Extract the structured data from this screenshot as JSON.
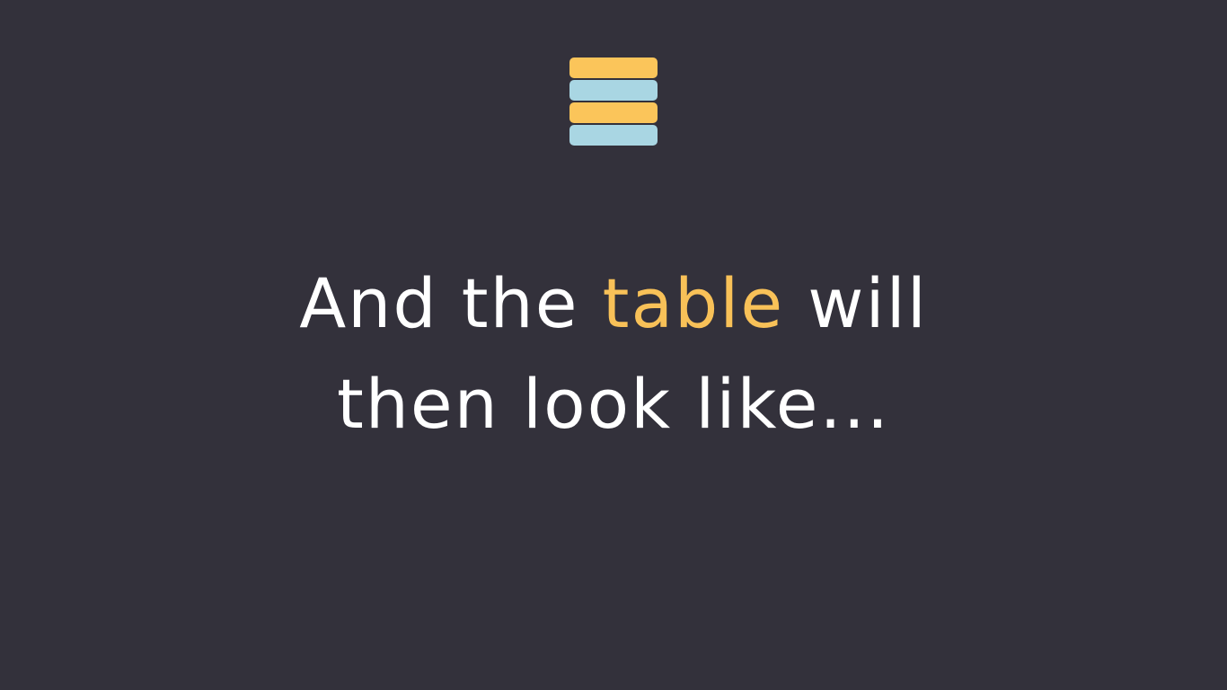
{
  "icon": {
    "name": "table-stack-icon",
    "bars": [
      {
        "color": "#fbc55a"
      },
      {
        "color": "#a9d6e3"
      },
      {
        "color": "#fbc55a"
      },
      {
        "color": "#a9d6e3"
      }
    ]
  },
  "caption": {
    "line1_before": "And the ",
    "line1_highlight": "table",
    "line1_after": " will",
    "line2": "then look like..."
  },
  "colors": {
    "background": "#33313b",
    "text": "#ffffff",
    "highlight": "#f8c158"
  }
}
